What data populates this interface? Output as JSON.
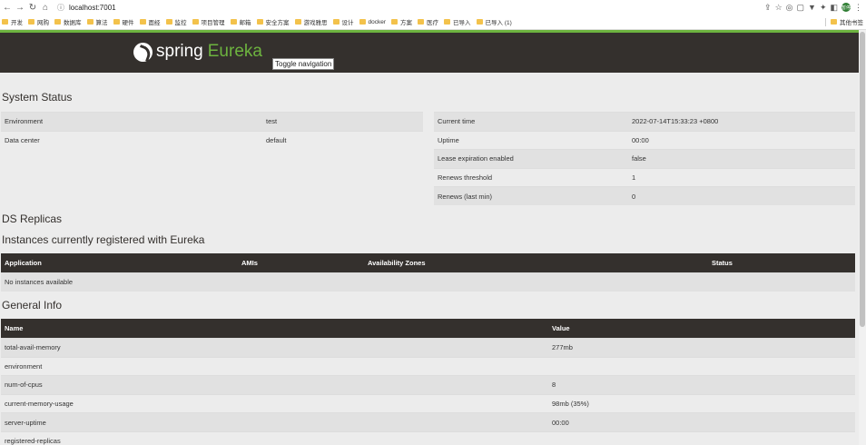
{
  "browser": {
    "url": "localhost:7001",
    "bookmarks": [
      "开发",
      "网购",
      "数据库",
      "算法",
      "硬件",
      "面经",
      "监控",
      "项目管理",
      "邮箱",
      "安全方案",
      "游戏雅思",
      "设计",
      "docker",
      "方案",
      "医疗",
      "已导入",
      "已导入 (1)"
    ],
    "right_bookmark": "其他书签",
    "avatar_text": "暂停"
  },
  "navbar": {
    "brand_spring": "spring",
    "brand_eureka": "Eureka",
    "toggle_tooltip": "Toggle navigation",
    "bg_color": "#34302d",
    "accent_color": "#6db33f"
  },
  "system_status": {
    "title": "System Status",
    "left": [
      {
        "key": "Environment",
        "value": "test"
      },
      {
        "key": "Data center",
        "value": "default"
      }
    ],
    "right": [
      {
        "key": "Current time",
        "value": "2022-07-14T15:33:23 +0800"
      },
      {
        "key": "Uptime",
        "value": "00:00"
      },
      {
        "key": "Lease expiration enabled",
        "value": "false"
      },
      {
        "key": "Renews threshold",
        "value": "1"
      },
      {
        "key": "Renews (last min)",
        "value": "0"
      }
    ]
  },
  "ds_replicas": {
    "title": "DS Replicas"
  },
  "instances": {
    "title": "Instances currently registered with Eureka",
    "columns": [
      "Application",
      "AMIs",
      "Availability Zones",
      "Status"
    ],
    "empty_text": "No instances available"
  },
  "general_info": {
    "title": "General Info",
    "columns": [
      "Name",
      "Value"
    ],
    "rows": [
      {
        "name": "total-avail-memory",
        "value": "277mb"
      },
      {
        "name": "environment",
        "value": ""
      },
      {
        "name": "num-of-cpus",
        "value": "8"
      },
      {
        "name": "current-memory-usage",
        "value": "98mb (35%)"
      },
      {
        "name": "server-uptime",
        "value": "00:00"
      },
      {
        "name": "registered-replicas",
        "value": ""
      }
    ]
  }
}
